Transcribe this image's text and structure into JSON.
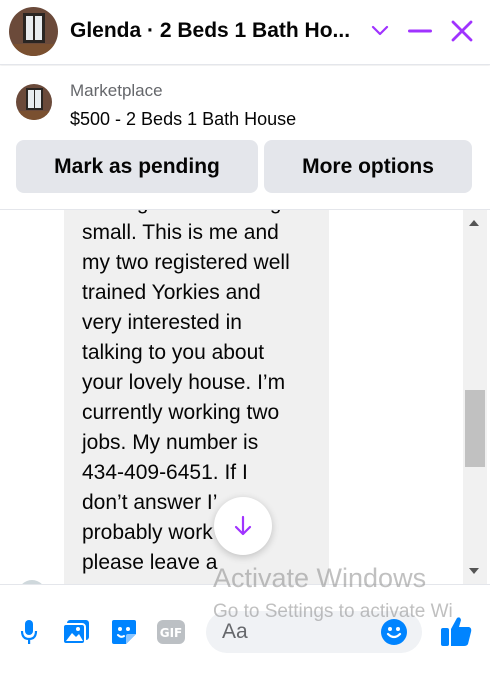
{
  "header": {
    "title": "Glenda · 2 Beds 1 Bath Ho...",
    "icons": [
      "chevron-down-icon",
      "minimize-icon",
      "close-icon"
    ],
    "accent": "#a033ff"
  },
  "listing": {
    "label": "Marketplace",
    "title": "$500 - 2 Beds 1 Bath House",
    "buttons": {
      "pending": "Mark as pending",
      "more": "More options"
    }
  },
  "message": {
    "text": "looking for something\nsmall. This is me and\nmy two registered well\ntrained Yorkies and\nvery interested in\ntalking to you about\nyour lovely house. I’m\ncurrently working two\njobs. My number is\n434-409-6451. If I\ndon’t answer I’\nprobably work\nplease leave a",
    "bubble_color": "#f0f0f0"
  },
  "composer": {
    "placeholder": "Aa",
    "icons": [
      "microphone-icon",
      "photo-icon",
      "sticker-icon",
      "gif-icon",
      "emoji-icon",
      "thumbs-up-icon"
    ],
    "gif_label": "GIF",
    "accent": "#0084ff"
  },
  "watermark": {
    "line1": "Activate Windows",
    "line2": "Go to Settings to activate Wi"
  }
}
